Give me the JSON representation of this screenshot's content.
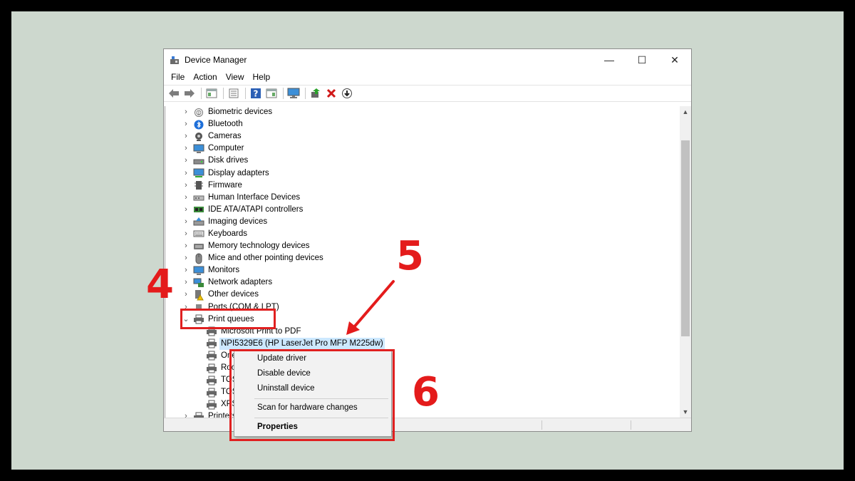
{
  "window": {
    "title": "Device Manager",
    "controls": {
      "minimize": "—",
      "maximize": "☐",
      "close": "✕"
    }
  },
  "menu": [
    "File",
    "Action",
    "View",
    "Help"
  ],
  "tree": {
    "categories": [
      {
        "label": "Biometric devices",
        "icon": "fingerprint-icon"
      },
      {
        "label": "Bluetooth",
        "icon": "bluetooth-icon"
      },
      {
        "label": "Cameras",
        "icon": "camera-icon"
      },
      {
        "label": "Computer",
        "icon": "computer-icon"
      },
      {
        "label": "Disk drives",
        "icon": "disk-drive-icon"
      },
      {
        "label": "Display adapters",
        "icon": "display-adapter-icon"
      },
      {
        "label": "Firmware",
        "icon": "firmware-icon"
      },
      {
        "label": "Human Interface Devices",
        "icon": "hid-icon"
      },
      {
        "label": "IDE ATA/ATAPI controllers",
        "icon": "ide-controller-icon"
      },
      {
        "label": "Imaging devices",
        "icon": "imaging-icon"
      },
      {
        "label": "Keyboards",
        "icon": "keyboard-icon"
      },
      {
        "label": "Memory technology devices",
        "icon": "memory-icon"
      },
      {
        "label": "Mice and other pointing devices",
        "icon": "mouse-icon"
      },
      {
        "label": "Monitors",
        "icon": "monitor-icon"
      },
      {
        "label": "Network adapters",
        "icon": "network-icon"
      },
      {
        "label": "Other devices",
        "icon": "other-devices-icon"
      },
      {
        "label": "Ports (COM & LPT)",
        "icon": "port-icon"
      },
      {
        "label": "Print queues",
        "icon": "printer-icon"
      }
    ],
    "print_queue_children": [
      "Microsoft Print to PDF",
      "NPI5329E6 (HP LaserJet Pro MFP M225dw)",
      "One",
      "Roo",
      "TOS",
      "TOS",
      "XPS"
    ],
    "after_children": "Printers"
  },
  "context_menu": {
    "items": [
      "Update driver",
      "Disable device",
      "Uninstall device",
      "Scan for hardware changes",
      "Properties"
    ]
  },
  "annotations": {
    "step4": "4",
    "step5": "5",
    "step6": "6"
  },
  "colors": {
    "highlight": "#e02020",
    "selection": "#cce8ff",
    "backdrop": "#cdd8ce"
  }
}
